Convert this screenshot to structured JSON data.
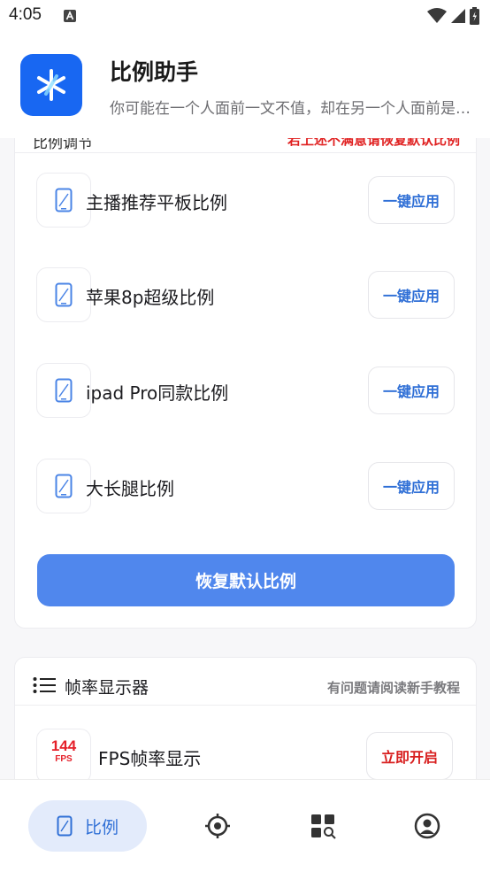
{
  "status_bar": {
    "time": "4:05"
  },
  "header": {
    "title": "比例助手",
    "subtitle": "你可能在一个人面前一文不值，却在另一个人面前是无价之宝"
  },
  "ratio_card": {
    "section_title": "比例调节",
    "hint": "若上述不满意请恢复默认比例",
    "items": [
      {
        "label": "主播推荐平板比例",
        "button": "一键应用"
      },
      {
        "label": "苹果8p超级比例",
        "button": "一键应用"
      },
      {
        "label": "ipad Pro同款比例",
        "button": "一键应用"
      },
      {
        "label": "大长腿比例",
        "button": "一键应用"
      }
    ],
    "restore_button": "恢复默认比例"
  },
  "fps_card": {
    "title": "帧率显示器",
    "hint": "有问题请阅读新手教程",
    "icon_number": "144",
    "icon_unit": "FPS",
    "item_label": "FPS帧率显示",
    "button": "立即开启"
  },
  "bottom_nav": {
    "active_label": "比例",
    "items": [
      "tablet-icon",
      "target-icon",
      "apps-search-icon",
      "profile-icon"
    ]
  },
  "colors": {
    "brand_blue": "#1867f2",
    "primary_button": "#5087ed",
    "accent_text": "#2f6fd6",
    "alert_red": "#e02020"
  }
}
